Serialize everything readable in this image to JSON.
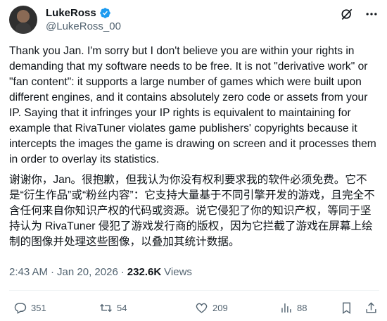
{
  "author": {
    "display_name": "LukeRoss",
    "handle": "@LukeRoss_00"
  },
  "tweet": {
    "text_en": "Thank you Jan. I'm sorry but I don't believe you are within your rights in demanding that my software needs to be free. It is not \"derivative work\" or \"fan content\": it supports a large number of games which were built upon different engines, and it contains absolutely zero code or assets from your IP. Saying that it infringes your IP rights is equivalent to maintaining for example that RivaTuner violates game publishers' copyrights because it intercepts the images the game is drawing on screen and it processes them in order to overlay its statistics.",
    "text_zh": "谢谢你，Jan。很抱歉，但我认为你没有权利要求我的软件必须免费。它不是“衍生作品”或“粉丝内容”：它支持大量基于不同引擎开发的游戏，且完全不含任何来自你知识产权的代码或资源。说它侵犯了你的知识产权，等同于坚持认为 RivaTuner 侵犯了游戏发行商的版权，因为它拦截了游戏在屏幕上绘制的图像并处理这些图像，以叠加其统计数据。",
    "time": "2:43 AM",
    "separator": "·",
    "date": "Jan 20, 2026",
    "views_count": "232.6K",
    "views_label": "Views"
  },
  "actions": {
    "replies": "351",
    "reposts": "54",
    "likes": "209",
    "views": "88"
  },
  "colors": {
    "text": "#0f1419",
    "secondary": "#536471",
    "verified": "#1d9bf0",
    "divider": "#eff3f4"
  }
}
